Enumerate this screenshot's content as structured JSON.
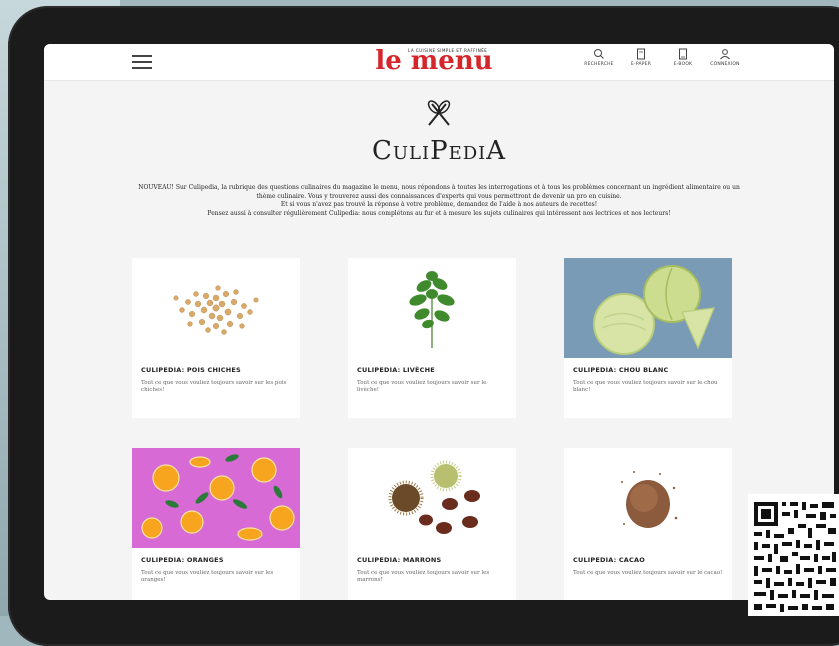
{
  "brand": {
    "name": "le menu",
    "tagline": "LA CUISINE SIMPLE ET RAFFINÉE",
    "color": "#d5262b"
  },
  "nav": [
    {
      "label": "RECHERCHE",
      "icon": "search-icon"
    },
    {
      "label": "E-PAPER",
      "icon": "e-paper-icon"
    },
    {
      "label": "E-BOOK",
      "icon": "e-book-icon"
    },
    {
      "label": "CONNEXION",
      "icon": "user-icon"
    }
  ],
  "page": {
    "title": "CuliPediA",
    "intro": [
      "NOUVEAU! Sur Culipedia, la rubrique des questions culinaires du magazine le menu, nous répondons à toutes les interrogations et à tous les problèmes concernant un ingrédient alimentaire ou un thème culinaire. Vous y trouverez aussi des connaissances d'experts qui vous permettront de devenir un pro en cuisine.",
      "Et si vous n'avez pas trouvé la réponse à votre problème, demandez de l'aide à nos auteurs de recettes!",
      "Pensez aussi à consulter régulièrement Culipedia: nous complétons au fur et à mesure les sujets culinaires qui intéressent nos lectrices et nos lecteurs!"
    ]
  },
  "cards": [
    {
      "title": "CULIPEDIA: POIS CHICHES",
      "desc": "Tout ce que vous vouliez toujours savoir sur les pois chiches!",
      "image": "chickpeas"
    },
    {
      "title": "CULIPEDIA: LIVÈCHE",
      "desc": "Tout ce que vous vouliez toujours savoir sur le livèche!",
      "image": "lovage"
    },
    {
      "title": "CULIPEDIA: CHOU BLANC",
      "desc": "Tout ce que vous vouliez toujours savoir sur le chou blanc!",
      "image": "white-cabbage"
    },
    {
      "title": "CULIPEDIA: ORANGES",
      "desc": "Tout ce que vous vouliez toujours savoir sur les oranges!",
      "image": "oranges"
    },
    {
      "title": "CULIPEDIA: MARRONS",
      "desc": "Tout ce que vous vouliez toujours savoir sur les marrons!",
      "image": "chestnuts"
    },
    {
      "title": "CULIPEDIA: CACAO",
      "desc": "Tout ce que vous vouliez toujours savoir sur le cacao!",
      "image": "cocoa"
    }
  ]
}
